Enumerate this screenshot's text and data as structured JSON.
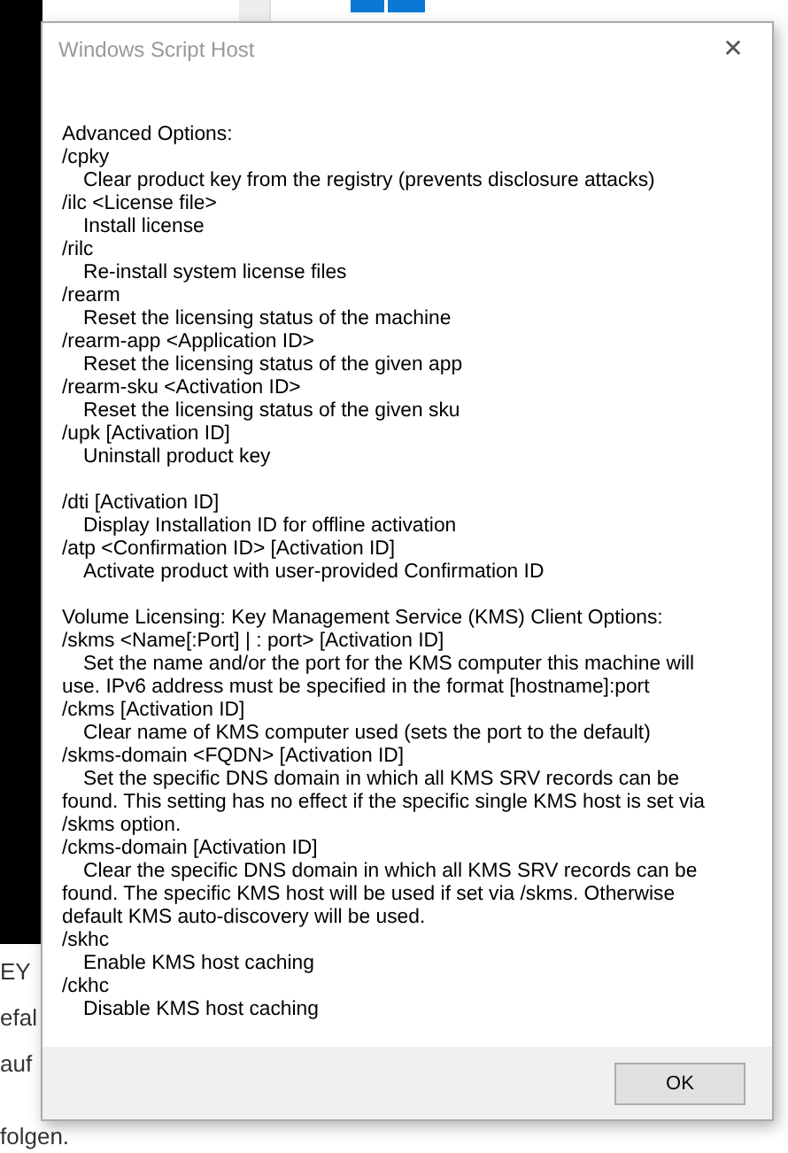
{
  "background": {
    "texts": [
      "EY",
      "efal",
      "auf",
      "folgen."
    ]
  },
  "dialog": {
    "title": "Windows Script Host",
    "sections": [
      {
        "heading": "Advanced Options:",
        "entries": [
          {
            "option": "/cpky",
            "description": "Clear product key from the registry (prevents disclosure attacks)"
          },
          {
            "option": "/ilc <License file>",
            "description": "Install license"
          },
          {
            "option": "/rilc",
            "description": "Re-install system license files"
          },
          {
            "option": "/rearm",
            "description": "Reset the licensing status of the machine"
          },
          {
            "option": "/rearm-app <Application ID>",
            "description": "Reset the licensing status of the given app"
          },
          {
            "option": "/rearm-sku <Activation ID>",
            "description": "Reset the licensing status of the given sku"
          },
          {
            "option": "/upk [Activation ID]",
            "description": "Uninstall product key"
          }
        ]
      },
      {
        "entries": [
          {
            "option": "/dti [Activation ID]",
            "description": "Display Installation ID for offline activation"
          },
          {
            "option": "/atp <Confirmation ID> [Activation ID]",
            "description": "Activate product with user-provided Confirmation ID"
          }
        ]
      },
      {
        "heading": "Volume Licensing: Key Management Service (KMS) Client Options:",
        "entries": [
          {
            "option": "/skms <Name[:Port] | : port> [Activation ID]",
            "description": "Set the name and/or the port for the KMS computer this machine will use. IPv6 address must be specified in the format [hostname]:port"
          },
          {
            "option": "/ckms [Activation ID]",
            "description": "Clear name of KMS computer used (sets the port to the default)"
          },
          {
            "option": "/skms-domain <FQDN> [Activation ID]",
            "description": "Set the specific DNS domain in which all KMS SRV records can be found. This setting has no effect if the specific single KMS host is set via /skms option."
          },
          {
            "option": "/ckms-domain [Activation ID]",
            "description": "Clear the specific DNS domain in which all KMS SRV records can be found. The specific KMS host will be used if set via /skms. Otherwise default KMS auto-discovery will be used."
          },
          {
            "option": "/skhc",
            "description": "Enable KMS host caching"
          },
          {
            "option": "/ckhc",
            "description": "Disable KMS host caching"
          }
        ]
      }
    ],
    "close": "✕",
    "buttons": [
      "OK"
    ]
  }
}
